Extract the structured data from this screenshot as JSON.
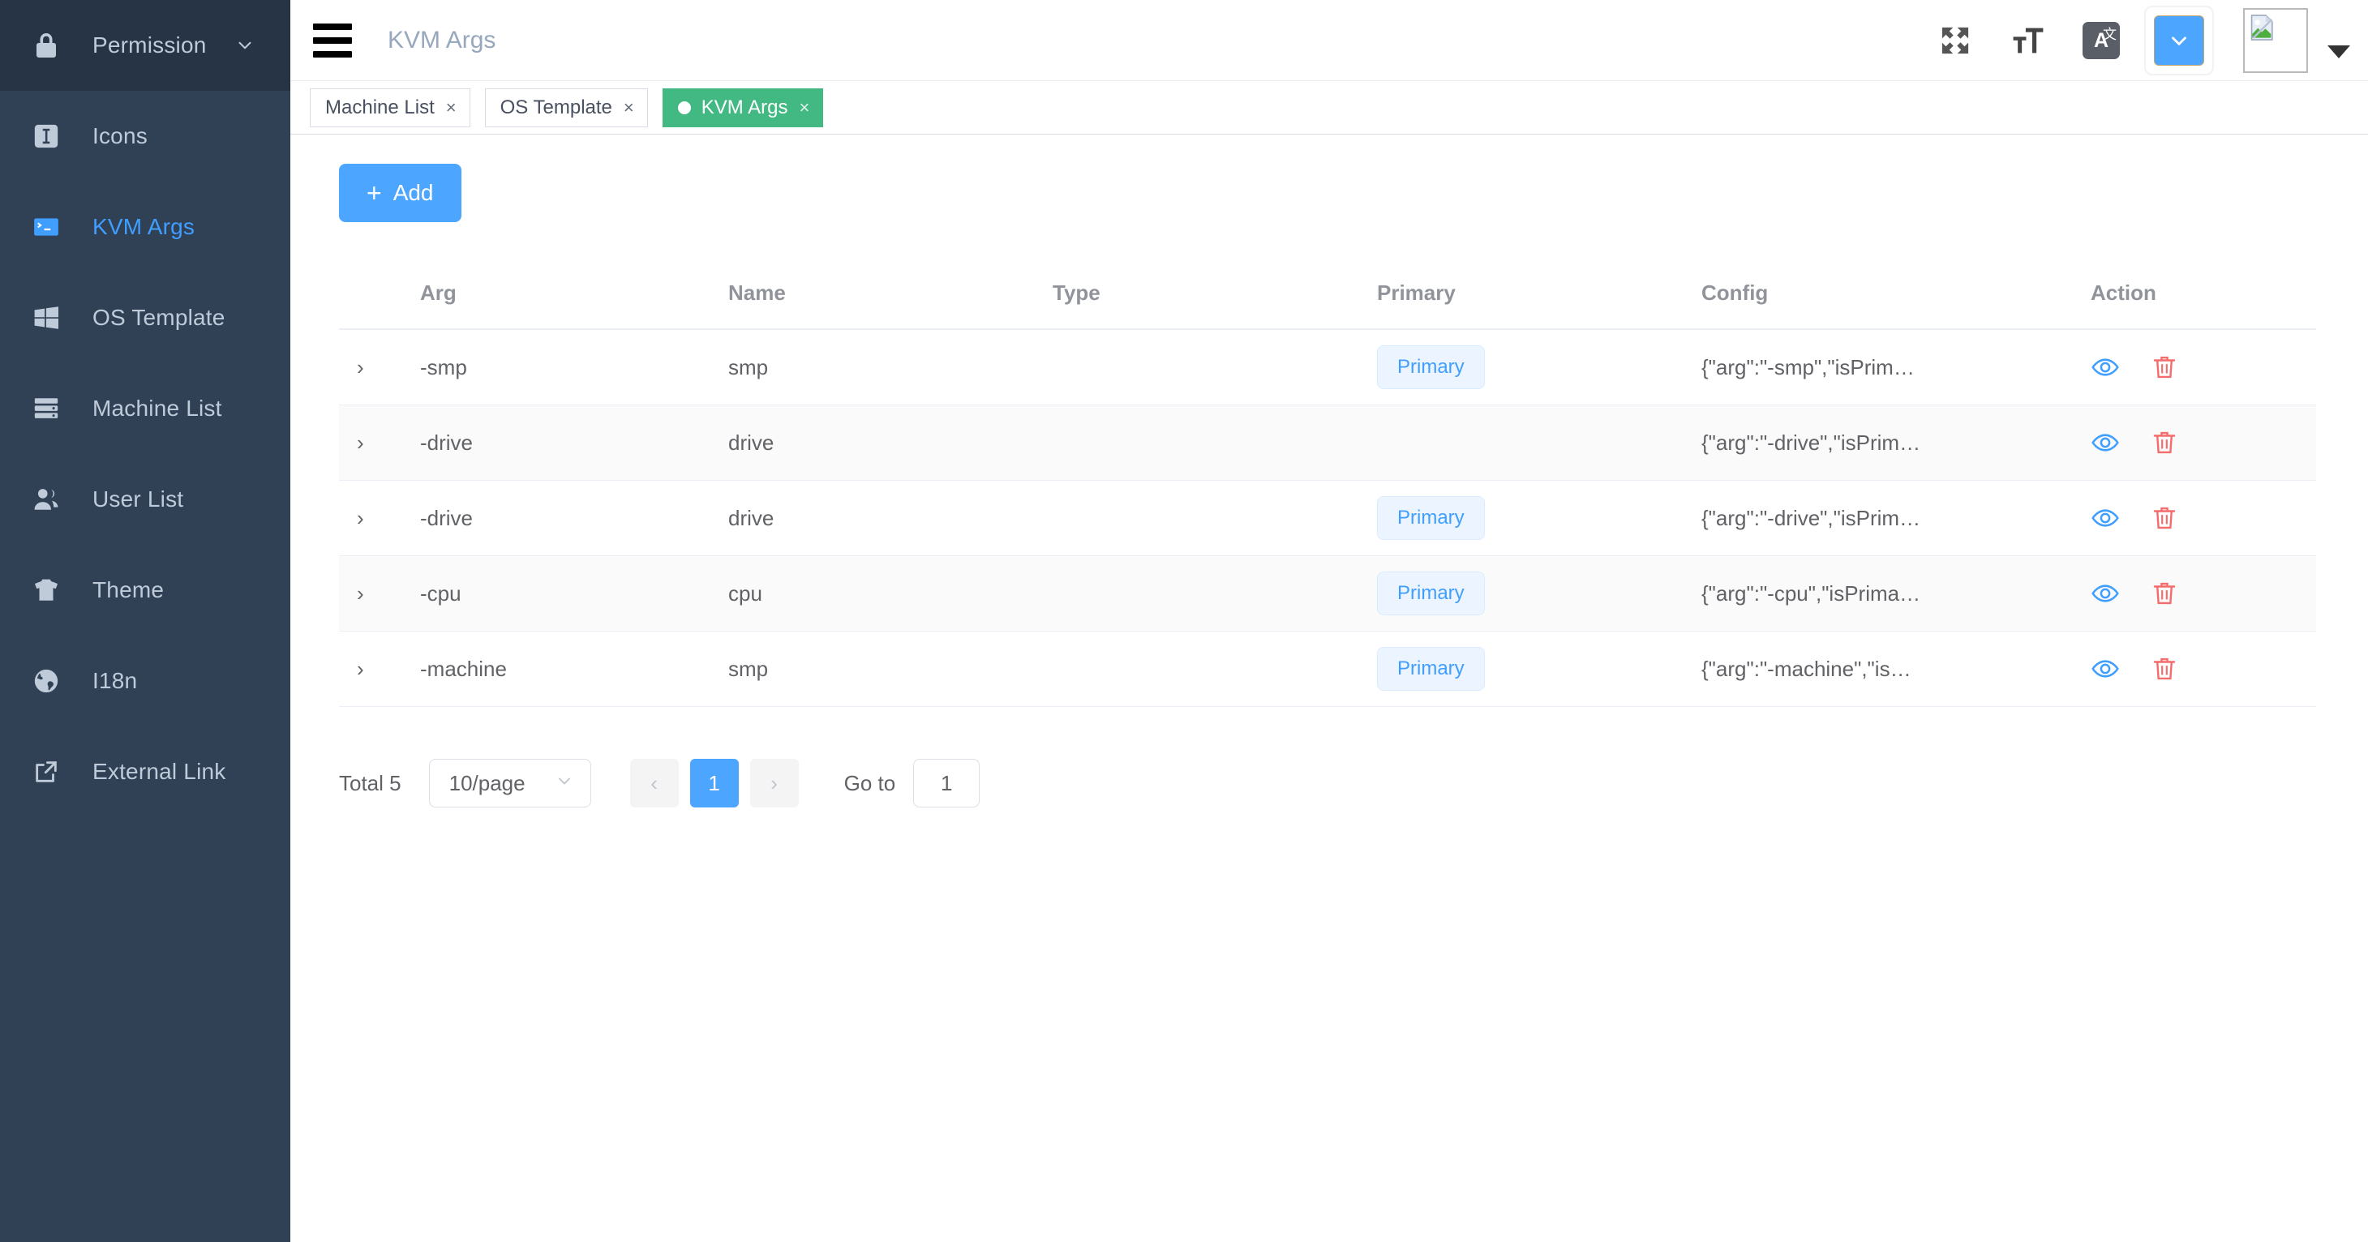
{
  "sidebar": {
    "items": [
      {
        "label": "Permission",
        "icon": "lock-icon",
        "active": false,
        "has_arrow": true
      },
      {
        "label": "Icons",
        "icon": "icons-icon",
        "active": false,
        "has_arrow": false
      },
      {
        "label": "KVM Args",
        "icon": "terminal-icon",
        "active": true,
        "has_arrow": false
      },
      {
        "label": "OS Template",
        "icon": "windows-icon",
        "active": false,
        "has_arrow": false
      },
      {
        "label": "Machine List",
        "icon": "server-icon",
        "active": false,
        "has_arrow": false
      },
      {
        "label": "User List",
        "icon": "user-icon",
        "active": false,
        "has_arrow": false
      },
      {
        "label": "Theme",
        "icon": "tshirt-icon",
        "active": false,
        "has_arrow": false
      },
      {
        "label": "I18n",
        "icon": "globe-icon",
        "active": false,
        "has_arrow": false
      },
      {
        "label": "External Link",
        "icon": "external-link-icon",
        "active": false,
        "has_arrow": false
      }
    ]
  },
  "navbar": {
    "title": "KVM Args",
    "icons": {
      "hamburger": "hamburger-icon",
      "fullscreen": "fullscreen-icon",
      "font_size": "font-size-icon",
      "language": "language-icon",
      "language_letter": "A",
      "language_cn": "文",
      "dropdown": "chevron-down-icon",
      "avatar": "broken-image-icon",
      "avatar_caret": "caret-down-icon"
    }
  },
  "tags": [
    {
      "label": "Machine List",
      "active": false,
      "closable": true
    },
    {
      "label": "OS Template",
      "active": false,
      "closable": true
    },
    {
      "label": "KVM Args",
      "active": true,
      "closable": true
    }
  ],
  "toolbar": {
    "add_label": "Add",
    "add_plus": "+"
  },
  "table": {
    "columns": [
      "Arg",
      "Name",
      "Type",
      "Primary",
      "Config",
      "Action"
    ],
    "rows": [
      {
        "expand": "›",
        "arg": "-smp",
        "name": "smp",
        "type": "",
        "primary": "Primary",
        "config": "{\"arg\":\"-smp\",\"isPrim…",
        "view_icon": "eye-icon",
        "delete_icon": "trash-icon"
      },
      {
        "expand": "›",
        "arg": "-drive",
        "name": "drive",
        "type": "",
        "primary": "",
        "config": "{\"arg\":\"-drive\",\"isPrim…",
        "view_icon": "eye-icon",
        "delete_icon": "trash-icon"
      },
      {
        "expand": "›",
        "arg": "-drive",
        "name": "drive",
        "type": "",
        "primary": "Primary",
        "config": "{\"arg\":\"-drive\",\"isPrim…",
        "view_icon": "eye-icon",
        "delete_icon": "trash-icon"
      },
      {
        "expand": "›",
        "arg": "-cpu",
        "name": "cpu",
        "type": "",
        "primary": "Primary",
        "config": "{\"arg\":\"-cpu\",\"isPrima…",
        "view_icon": "eye-icon",
        "delete_icon": "trash-icon"
      },
      {
        "expand": "›",
        "arg": "-machine",
        "name": "smp",
        "type": "",
        "primary": "Primary",
        "config": "{\"arg\":\"-machine\",\"is…",
        "view_icon": "eye-icon",
        "delete_icon": "trash-icon"
      }
    ]
  },
  "pagination": {
    "total_label": "Total 5",
    "page_size": "10/page",
    "prev": "‹",
    "next": "›",
    "pages": [
      "1"
    ],
    "current_page": "1",
    "goto_label": "Go to",
    "goto_value": "1"
  },
  "colors": {
    "sidebar_bg": "#304156",
    "sidebar_submenu_bg": "#263445",
    "accent_blue": "#4ca6ff",
    "active_tag_green": "#42b983",
    "primary_badge_text": "#409eff",
    "delete_red": "#f56c6c"
  }
}
